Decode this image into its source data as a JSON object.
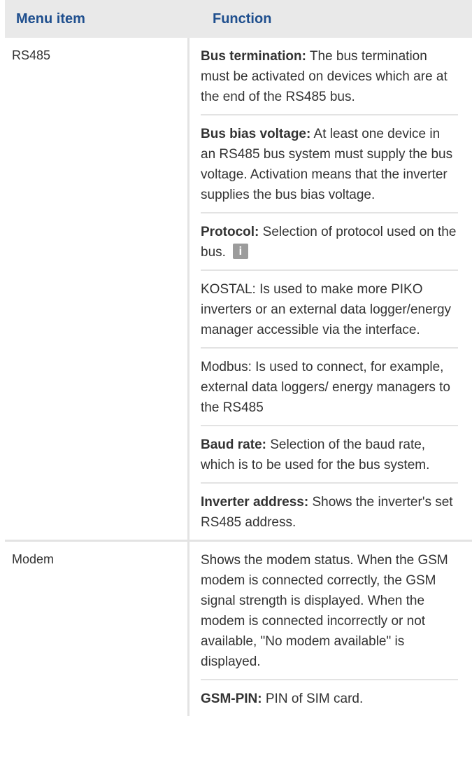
{
  "header": {
    "col_menu_item": "Menu item",
    "col_function": "Function"
  },
  "rows": [
    {
      "menu_item": "RS485",
      "paragraphs": [
        {
          "bold": "Bus termination:",
          "text": " The bus termination must be activated on devices which are at the end of the RS485 bus."
        },
        {
          "bold": "Bus bias voltage:",
          "text": " At least one device in an RS485 bus system must supply the bus voltage. Activation means that the inverter supplies the bus bias voltage."
        },
        {
          "bold": "Protocol:",
          "text": " Selection of protocol used on the bus.",
          "icon": "info-icon"
        },
        {
          "bold": "",
          "text": "KOSTAL: Is used to make more PIKO inverters or an external data logger/energy manager accessible via the interface."
        },
        {
          "bold": "",
          "text": "Modbus: Is used to connect, for example, external data loggers/ energy managers to the RS485"
        },
        {
          "bold": "Baud rate:",
          "text": " Selection of the baud rate, which is to be used for the bus system."
        },
        {
          "bold": "Inverter address:",
          "text": " Shows the inverter's set RS485 address."
        }
      ]
    },
    {
      "menu_item": "Modem",
      "paragraphs": [
        {
          "bold": "",
          "text": "Shows the modem status. When the GSM modem is connected correctly, the GSM signal strength is displayed. When the modem is connected incorrectly or not available, \"No modem available\" is displayed."
        },
        {
          "bold": "GSM-PIN:",
          "text": " PIN of SIM card."
        }
      ]
    }
  ],
  "icon_glyph": "i"
}
